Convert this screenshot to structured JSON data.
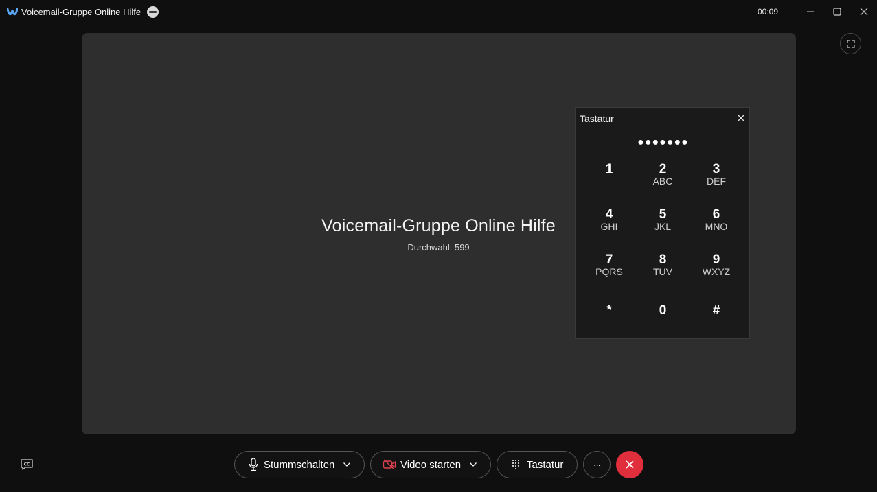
{
  "window": {
    "title": "Voicemail-Gruppe Online Hilfe",
    "timer": "00:09",
    "icons": {
      "app": "webex-icon",
      "status": "do-not-disturb-icon",
      "minimize": "minimize-icon",
      "maximize": "maximize-icon",
      "close": "close-icon"
    }
  },
  "call": {
    "name": "Voicemail-Gruppe Online Hilfe",
    "extension": "Durchwahl: 599"
  },
  "keypad": {
    "title": "Tastatur",
    "display": "●●●●●●●",
    "keys": [
      {
        "digit": "1",
        "letters": ""
      },
      {
        "digit": "2",
        "letters": "ABC"
      },
      {
        "digit": "3",
        "letters": "DEF"
      },
      {
        "digit": "4",
        "letters": "GHI"
      },
      {
        "digit": "5",
        "letters": "JKL"
      },
      {
        "digit": "6",
        "letters": "MNO"
      },
      {
        "digit": "7",
        "letters": "PQRS"
      },
      {
        "digit": "8",
        "letters": "TUV"
      },
      {
        "digit": "9",
        "letters": "WXYZ"
      },
      {
        "digit": "*",
        "letters": ""
      },
      {
        "digit": "0",
        "letters": ""
      },
      {
        "digit": "#",
        "letters": ""
      }
    ]
  },
  "controls": {
    "mute": "Stummschalten",
    "video": "Video starten",
    "keypad": "Tastatur",
    "more": "···"
  },
  "colors": {
    "background": "#0f0f0f",
    "stage": "#2e2e2e",
    "end_call": "#e02e3c",
    "video_off": "#e0434f"
  }
}
